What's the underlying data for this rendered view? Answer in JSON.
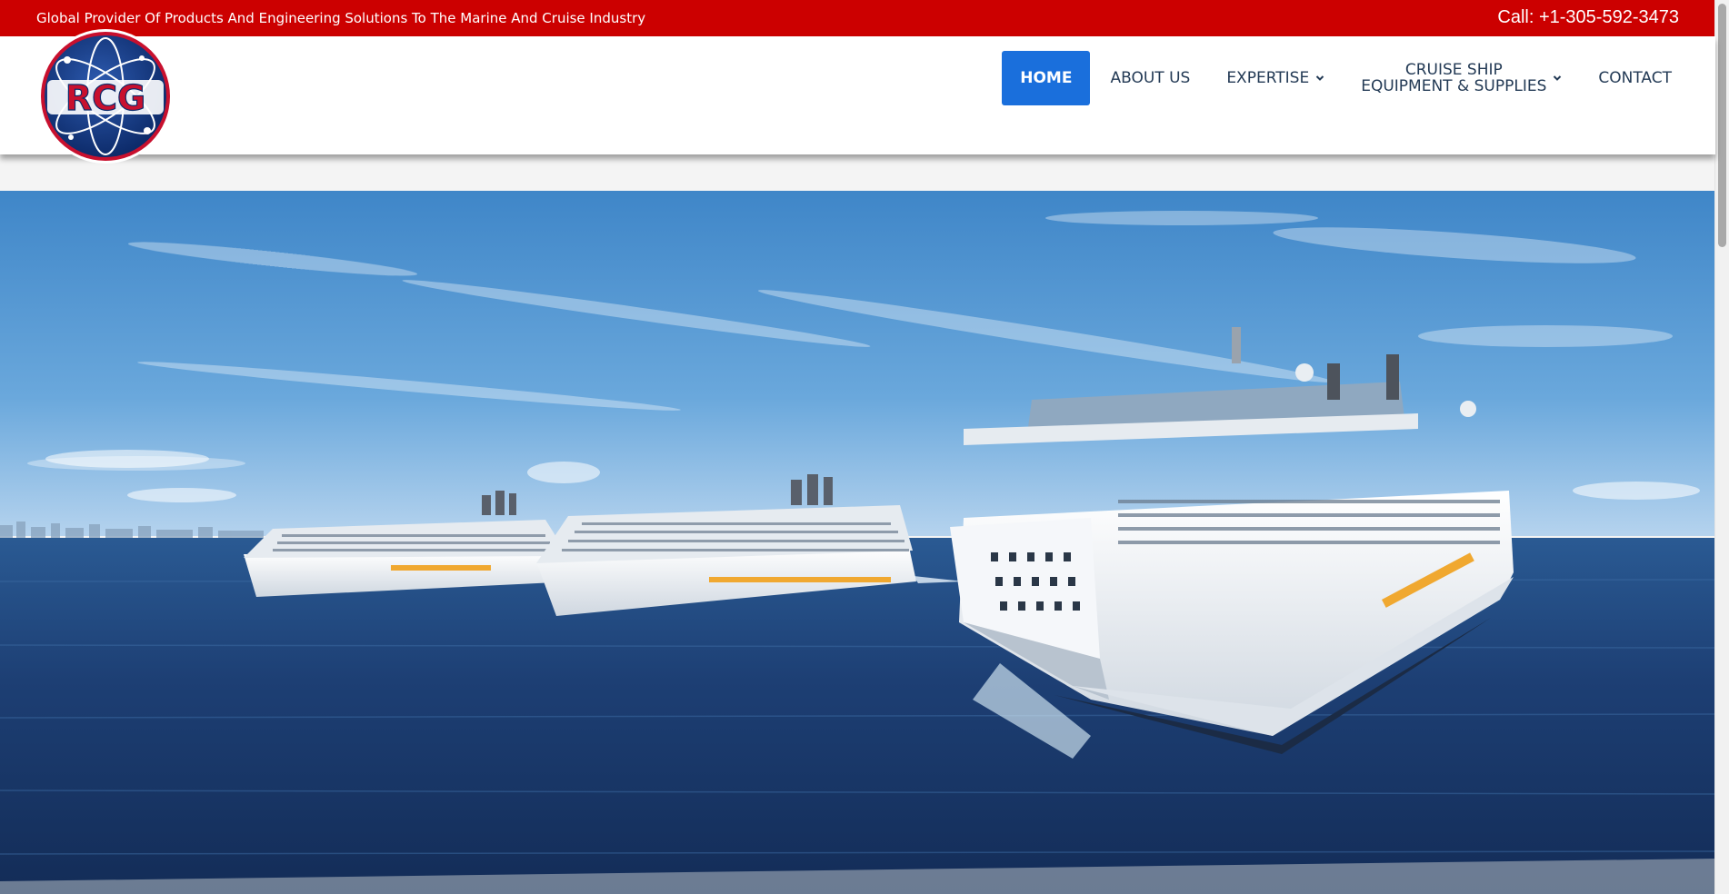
{
  "topbar": {
    "tagline": "Global Provider Of Products And Engineering Solutions To The Marine And Cruise Industry",
    "phone": "Call: +1-305-592-3473"
  },
  "logo": {
    "text": "RCG"
  },
  "nav": {
    "items": [
      {
        "label": "HOME",
        "active": true
      },
      {
        "label": "ABOUT US"
      },
      {
        "label": "EXPERTISE",
        "dropdown": true
      },
      {
        "label_line1": "CRUISE SHIP",
        "label_line2": "EQUIPMENT & SUPPLIES",
        "dropdown": true
      },
      {
        "label": "CONTACT"
      }
    ]
  },
  "hero": {
    "icon": "cruise-ships-image"
  },
  "colors": {
    "topbar": "#cc0000",
    "nav_active": "#1a6fdc",
    "nav_text": "#233a55",
    "sea": "#1d3f74",
    "sky": "#4f93cf"
  }
}
